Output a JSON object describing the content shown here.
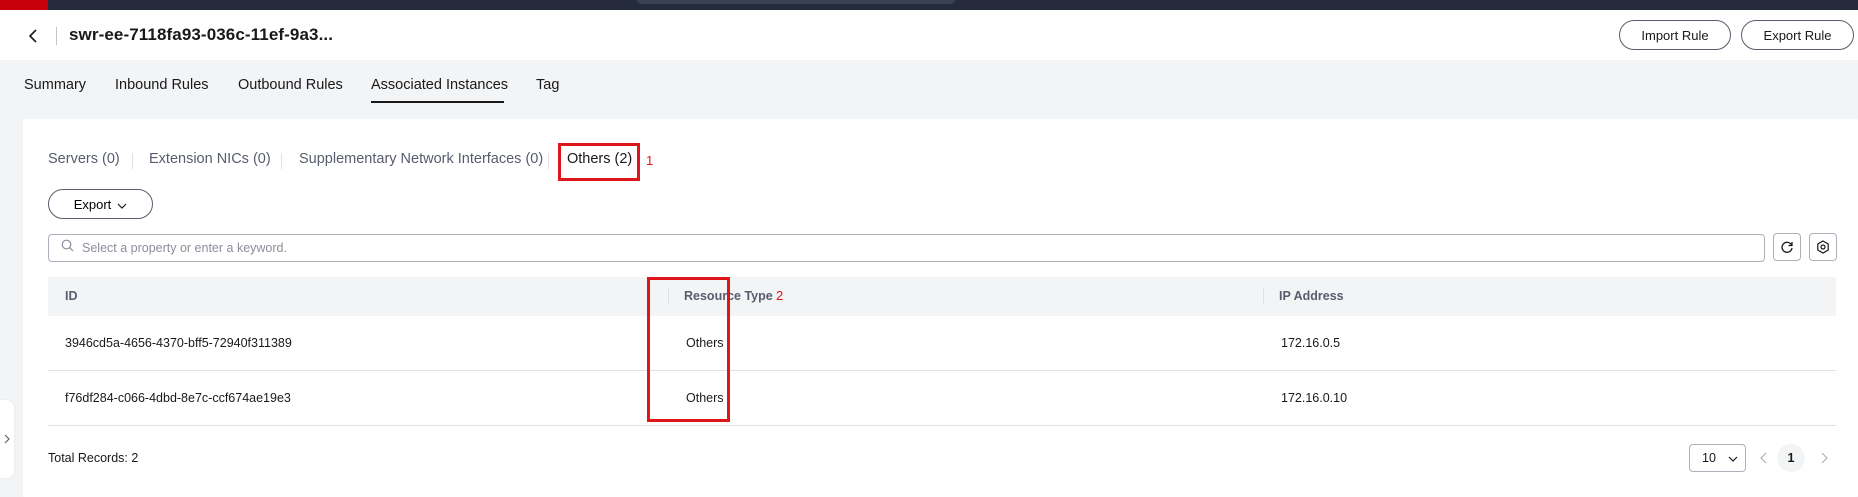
{
  "header": {
    "title": "swr-ee-7118fa93-036c-11ef-9a3...",
    "import_label": "Import Rule",
    "export_label": "Export Rule"
  },
  "tabs": [
    {
      "label": "Summary"
    },
    {
      "label": "Inbound Rules"
    },
    {
      "label": "Outbound Rules"
    },
    {
      "label": "Associated Instances",
      "active": true
    },
    {
      "label": "Tag"
    }
  ],
  "subtabs": [
    {
      "label": "Servers (0)"
    },
    {
      "label": "Extension NICs (0)"
    },
    {
      "label": "Supplementary Network Interfaces (0)"
    },
    {
      "label": "Others (2)",
      "active": true
    }
  ],
  "annotations": {
    "subtab_marker": "1",
    "column_marker": "2",
    "color": "#e0151a"
  },
  "toolbar": {
    "export_label": "Export"
  },
  "search": {
    "placeholder": "Select a property or enter a keyword."
  },
  "table": {
    "columns": [
      "ID",
      "Resource Type",
      "IP Address"
    ],
    "rows": [
      [
        "3946cd5a-4656-4370-bff5-72940f311389",
        "Others",
        "172.16.0.5"
      ],
      [
        "f76df284-c066-4dbd-8e7c-ccf674ae19e3",
        "Others",
        "172.16.0.10"
      ]
    ]
  },
  "footer": {
    "total_label": "Total Records: 2",
    "page_size": "10",
    "current_page": "1"
  },
  "icons": [
    "back-arrow-icon",
    "chevron-down-icon",
    "search-icon",
    "refresh-icon",
    "settings-icon",
    "chevron-left-icon",
    "chevron-right-icon"
  ]
}
